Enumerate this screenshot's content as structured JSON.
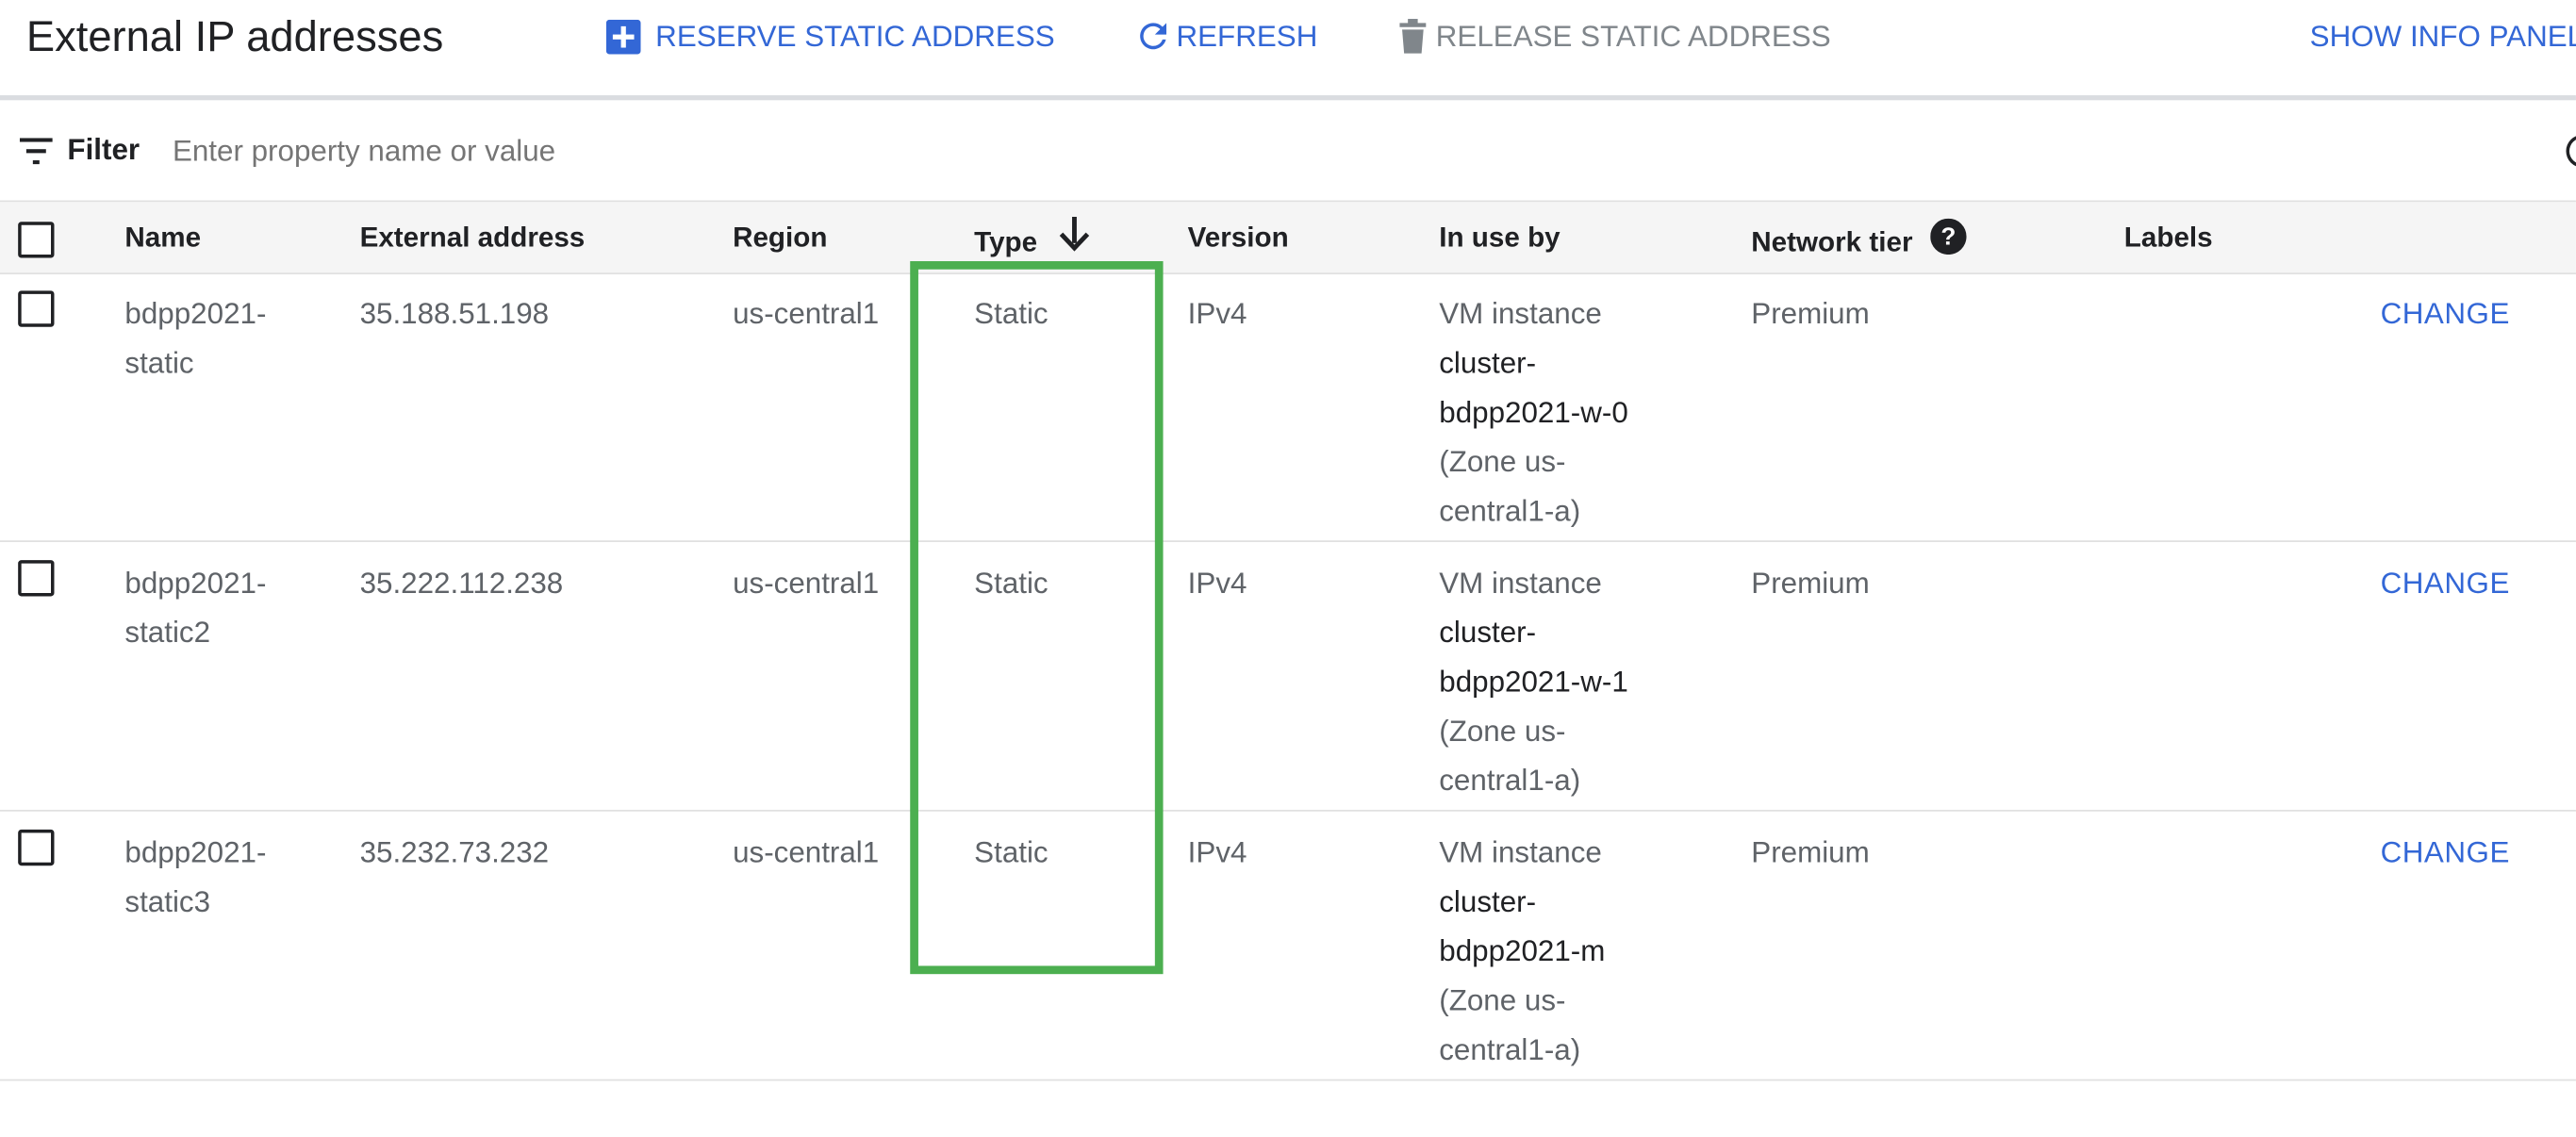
{
  "header": {
    "title": "External IP addresses",
    "reserve_label": "RESERVE STATIC ADDRESS",
    "refresh_label": "REFRESH",
    "release_label": "RELEASE STATIC ADDRESS",
    "show_info_label": "SHOW INFO PANEL"
  },
  "filter": {
    "label": "Filter",
    "placeholder": "Enter property name or value"
  },
  "table": {
    "columns": {
      "name": "Name",
      "external_address": "External address",
      "region": "Region",
      "type": "Type",
      "version": "Version",
      "in_use_by": "In use by",
      "network_tier": "Network tier",
      "labels": "Labels"
    },
    "type_sort": "descending",
    "rows": [
      {
        "name_line1": "bdpp2021-",
        "name_line2": "static",
        "address": "35.188.51.198",
        "region": "us-central1",
        "type": "Static",
        "version": "IPv4",
        "in_use_line1": "VM instance",
        "in_use_line2": "cluster-",
        "in_use_line3": "bdpp2021-w-0",
        "in_use_line4": "(Zone us-",
        "in_use_line5": "central1-a)",
        "tier": "Premium",
        "action": "CHANGE"
      },
      {
        "name_line1": "bdpp2021-",
        "name_line2": "static2",
        "address": "35.222.112.238",
        "region": "us-central1",
        "type": "Static",
        "version": "IPv4",
        "in_use_line1": "VM instance",
        "in_use_line2": "cluster-",
        "in_use_line3": "bdpp2021-w-1",
        "in_use_line4": "(Zone us-",
        "in_use_line5": "central1-a)",
        "tier": "Premium",
        "action": "CHANGE"
      },
      {
        "name_line1": "bdpp2021-",
        "name_line2": "static3",
        "address": "35.232.73.232",
        "region": "us-central1",
        "type": "Static",
        "version": "IPv4",
        "in_use_line1": "VM instance",
        "in_use_line2": "cluster-",
        "in_use_line3": "bdpp2021-m",
        "in_use_line4": "(Zone us-",
        "in_use_line5": "central1-a)",
        "tier": "Premium",
        "action": "CHANGE"
      }
    ]
  },
  "colors": {
    "accent_blue": "#3367d6",
    "highlight_green": "#4caf50",
    "disabled_grey": "#80868b"
  },
  "icons": {
    "reserve": "add-box-icon",
    "refresh": "refresh-icon",
    "release": "trash-icon",
    "filter": "filter-list-icon",
    "sort": "arrow-down-icon",
    "help": "help-circle-icon"
  }
}
